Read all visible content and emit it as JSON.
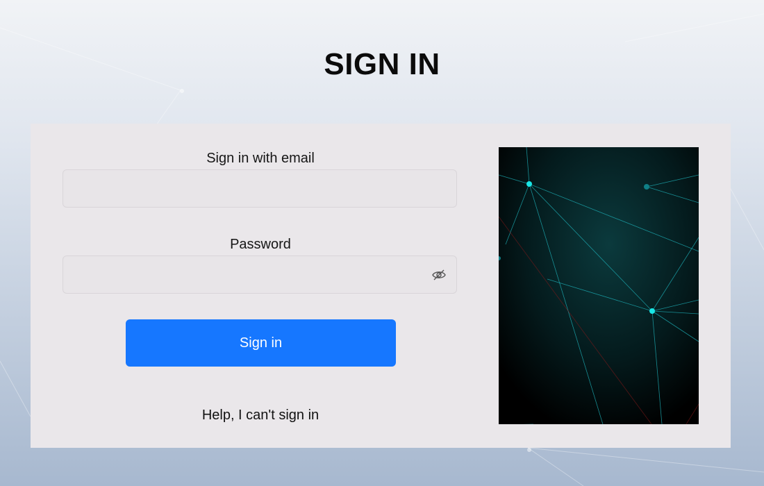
{
  "page": {
    "title": "SIGN IN"
  },
  "form": {
    "email_label": "Sign in with email",
    "email_value": "",
    "password_label": "Password",
    "password_value": "",
    "password_toggle_icon": "eye-slash-icon",
    "submit_label": "Sign in",
    "help_link": "Help, I can't sign in"
  },
  "colors": {
    "primary_button": "#1677ff",
    "card_background": "#eae7ea",
    "hero_node": "#19e6e6"
  }
}
